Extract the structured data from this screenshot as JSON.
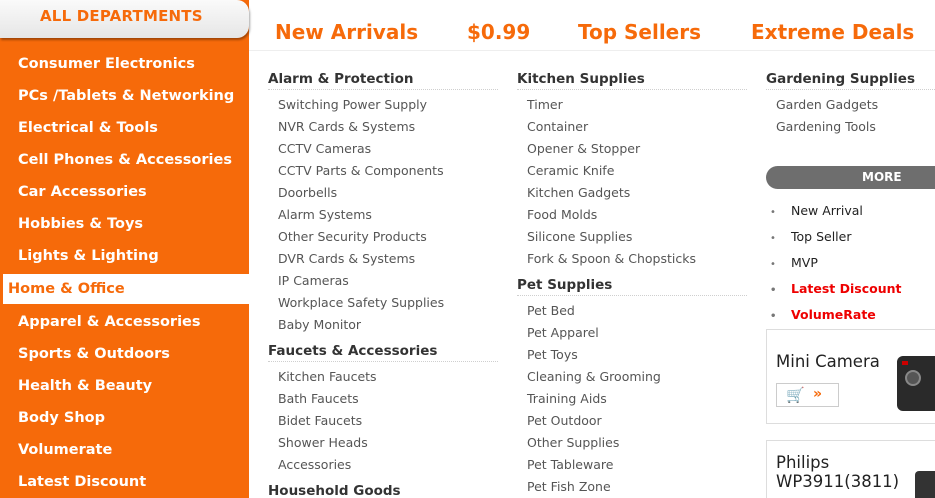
{
  "sidebar": {
    "header": "ALL DEPARTMENTS",
    "items": [
      {
        "label": "Consumer Electronics"
      },
      {
        "label": "PCs /Tablets & Networking"
      },
      {
        "label": "Electrical & Tools"
      },
      {
        "label": "Cell Phones & Accessories"
      },
      {
        "label": "Car Accessories"
      },
      {
        "label": "Hobbies & Toys"
      },
      {
        "label": "Lights & Lighting"
      },
      {
        "label": "Home & Office"
      },
      {
        "label": "Apparel & Accessories"
      },
      {
        "label": "Sports & Outdoors"
      },
      {
        "label": "Health & Beauty"
      },
      {
        "label": "Body Shop"
      },
      {
        "label": "Volumerate"
      },
      {
        "label": "Latest Discount"
      }
    ],
    "active_index": 7
  },
  "top_nav": [
    "New Arrivals",
    "$0.99",
    "Top Sellers",
    "Extreme Deals"
  ],
  "columns": [
    {
      "groups": [
        {
          "title": "Alarm & Protection",
          "items": [
            "Switching Power Supply",
            "NVR Cards & Systems",
            "CCTV Cameras",
            "CCTV Parts & Components",
            "Doorbells",
            "Alarm Systems",
            "Other Security Products",
            "DVR Cards & Systems",
            "IP Cameras",
            "Workplace Safety Supplies",
            "Baby Monitor"
          ]
        },
        {
          "title": "Faucets & Accessories",
          "items": [
            "Kitchen Faucets",
            "Bath Faucets",
            "Bidet Faucets",
            "Shower Heads",
            "Accessories"
          ]
        },
        {
          "title": "Household Goods",
          "items": []
        }
      ]
    },
    {
      "groups": [
        {
          "title": "Kitchen Supplies",
          "items": [
            "Timer",
            "Container",
            "Opener & Stopper",
            "Ceramic Knife",
            "Kitchen Gadgets",
            "Food Molds",
            "Silicone Supplies",
            "Fork & Spoon & Chopsticks"
          ]
        },
        {
          "title": "Pet Supplies",
          "items": [
            "Pet Bed",
            "Pet Apparel",
            "Pet Toys",
            "Cleaning & Grooming",
            "Training Aids",
            "Pet Outdoor",
            "Other Supplies",
            "Pet Tableware",
            "Pet Fish Zone"
          ]
        }
      ]
    },
    {
      "groups": [
        {
          "title": "Gardening Supplies",
          "items": [
            "Garden Gadgets",
            "Gardening Tools"
          ]
        }
      ]
    }
  ],
  "more": {
    "label": "MORE",
    "items": [
      {
        "label": "New Arrival",
        "highlight": false
      },
      {
        "label": "Top Seller",
        "highlight": false
      },
      {
        "label": "MVP",
        "highlight": false
      },
      {
        "label": "Latest Discount",
        "highlight": true
      },
      {
        "label": "VolumeRate",
        "highlight": true
      }
    ]
  },
  "promos": [
    {
      "title": "Mini Camera"
    },
    {
      "title": "Philips WP3911(3811)"
    }
  ],
  "colors": {
    "accent": "#f66a0a",
    "highlight_red": "#e00000",
    "more_bar": "#6e6e6e"
  }
}
